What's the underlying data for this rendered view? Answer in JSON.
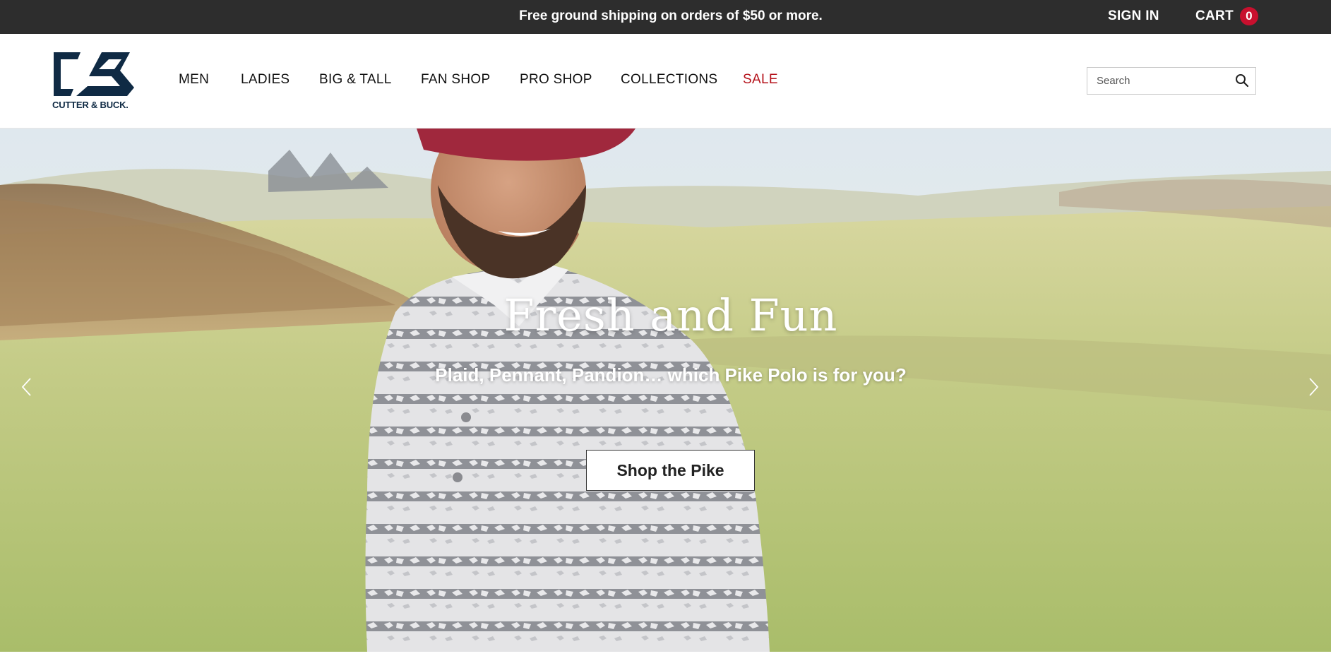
{
  "promo_bar": {
    "message": "Free ground shipping on orders of $50 or more.",
    "sign_in_label": "SIGN IN",
    "cart_label": "CART",
    "cart_count": "0"
  },
  "header": {
    "logo_text": "CUTTER & BUCK.",
    "nav": [
      {
        "label": "MEN"
      },
      {
        "label": "LADIES"
      },
      {
        "label": "BIG & TALL"
      },
      {
        "label": "FAN SHOP"
      },
      {
        "label": "PRO SHOP"
      },
      {
        "label": "COLLECTIONS"
      },
      {
        "label": "SALE"
      }
    ],
    "search": {
      "placeholder": "Search",
      "value": ""
    }
  },
  "hero": {
    "title": "Fresh and Fun",
    "subtitle": "Plaid, Pennant, Pandion… which Pike Polo is for you?",
    "cta_label": "Shop the Pike"
  },
  "colors": {
    "promo_bar_bg": "#2d2d2d",
    "brand_navy": "#0f2a44",
    "sale_red": "#b5121b",
    "cart_badge": "#c8102e"
  },
  "icons": {
    "search": "search-icon",
    "carousel_prev": "chevron-left-icon",
    "carousel_next": "chevron-right-icon"
  }
}
